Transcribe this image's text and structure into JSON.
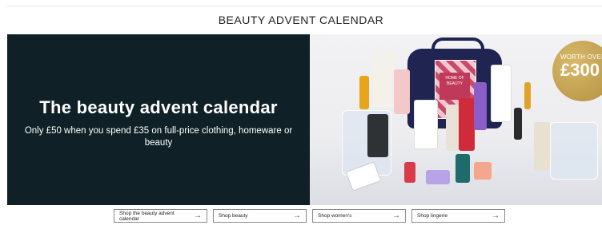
{
  "section": {
    "title": "BEAUTY ADVENT CALENDAR"
  },
  "banner": {
    "headline": "The beauty advent calendar",
    "subtext": "Only £50 when you spend £35 on full-price clothing, homeware or beauty",
    "case_label": "HOME OF BEAUTY",
    "badge": {
      "line1": "WORTH OVER",
      "line2": "£300"
    },
    "colors": {
      "panel": "#0f2126",
      "badge_gold": "#c4a252"
    }
  },
  "buttons": [
    {
      "label": "Shop the beauty advent calendar",
      "icon": "arrow-right-icon"
    },
    {
      "label": "Shop beauty",
      "icon": "arrow-right-icon"
    },
    {
      "label": "Shop women's",
      "icon": "arrow-right-icon"
    },
    {
      "label": "Shop lingerie",
      "icon": "arrow-right-icon"
    }
  ]
}
